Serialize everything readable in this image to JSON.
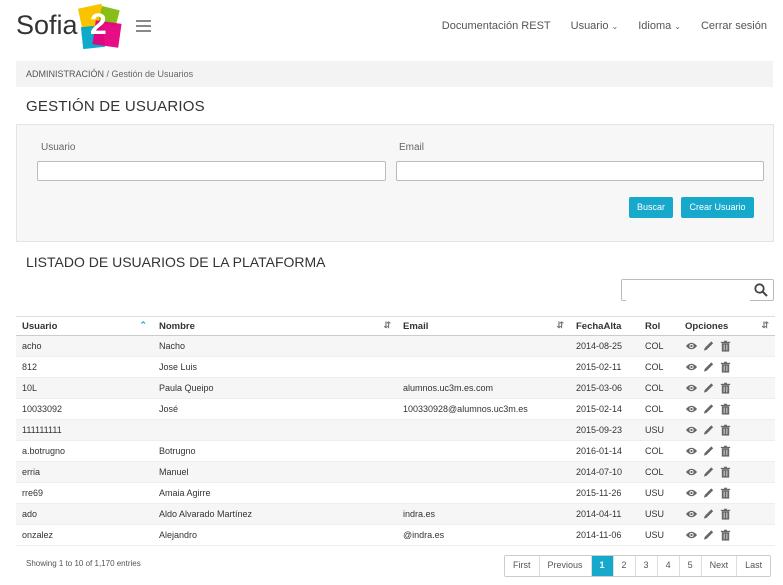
{
  "header": {
    "logo_text": "Sofia",
    "logo_number": "2",
    "nav": [
      {
        "label": "Documentación REST",
        "dropdown": false
      },
      {
        "label": "Usuario",
        "dropdown": true
      },
      {
        "label": "Idioma",
        "dropdown": true
      },
      {
        "label": "Cerrar sesión",
        "dropdown": false
      }
    ]
  },
  "breadcrumb": {
    "root": "ADMINISTRACIÓN",
    "separator": " / ",
    "current": "Gestión de Usuarios"
  },
  "page_title": "GESTIÓN DE USUARIOS",
  "filters": {
    "usuario_label": "Usuario",
    "usuario_value": "",
    "email_label": "Email",
    "email_value": "",
    "search_button": "Buscar",
    "create_button": "Crear Usuario"
  },
  "list_title": "LISTADO DE USUARIOS DE LA PLATAFORMA",
  "table_search": {
    "value": ""
  },
  "table": {
    "columns": [
      "Usuario",
      "Nombre",
      "Email",
      "FechaAlta",
      "Rol",
      "Opciones"
    ],
    "rows": [
      {
        "usuario": "acho",
        "nombre": "Nacho",
        "email": "",
        "fecha": "2014-08-25",
        "rol": "COL"
      },
      {
        "usuario": "812",
        "nombre": "Jose Luis",
        "email": "",
        "fecha": "2015-02-11",
        "rol": "COL"
      },
      {
        "usuario": "10L",
        "nombre": "Paula Queipo",
        "email": "alumnos.uc3m.es.com",
        "fecha": "2015-03-06",
        "rol": "COL"
      },
      {
        "usuario": "10033092",
        "nombre": "José",
        "email": "100330928@alumnos.uc3m.es",
        "fecha": "2015-02-14",
        "rol": "COL"
      },
      {
        "usuario": "111111111",
        "nombre": "",
        "email": "",
        "fecha": "2015-09-23",
        "rol": "USU"
      },
      {
        "usuario": "a.botrugno",
        "nombre": "Botrugno",
        "email": "",
        "fecha": "2016-01-14",
        "rol": "COL"
      },
      {
        "usuario": "erria",
        "nombre": "Manuel",
        "email": "",
        "fecha": "2014-07-10",
        "rol": "COL"
      },
      {
        "usuario": "rre69",
        "nombre": "Amaia Agirre",
        "email": "",
        "fecha": "2015-11-26",
        "rol": "USU"
      },
      {
        "usuario": "ado",
        "nombre": "Aldo Alvarado Martínez",
        "email": "indra.es",
        "fecha": "2014-04-11",
        "rol": "USU"
      },
      {
        "usuario": "onzalez",
        "nombre": "Alejandro",
        "email": "@indra.es",
        "fecha": "2014-11-06",
        "rol": "USU"
      }
    ]
  },
  "footer": {
    "info": "Showing 1 to 10 of 1,170 entries",
    "pager": [
      "First",
      "Previous",
      "1",
      "2",
      "3",
      "4",
      "5",
      "Next",
      "Last"
    ],
    "current_page": "1"
  },
  "colors": {
    "accent": "#17a9cc"
  }
}
